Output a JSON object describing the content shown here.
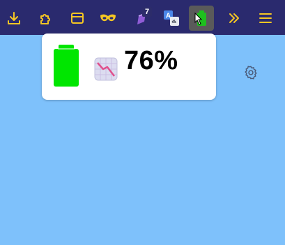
{
  "toolbar": {
    "background": "#2a2a6e",
    "icon_color": "#f5c623",
    "items": [
      {
        "name": "download",
        "icon": "download-icon"
      },
      {
        "name": "extensions",
        "icon": "puzzle-icon"
      },
      {
        "name": "sidebar",
        "icon": "window-icon"
      },
      {
        "name": "mask",
        "icon": "mask-icon"
      },
      {
        "name": "notes",
        "icon": "purple-extension-icon",
        "badge": "7"
      },
      {
        "name": "translate",
        "icon": "translate-icon"
      },
      {
        "name": "battery",
        "icon": "battery-extension-icon",
        "active": true
      },
      {
        "name": "more",
        "icon": "double-chevron-icon"
      },
      {
        "name": "menu",
        "icon": "hamburger-icon"
      }
    ]
  },
  "popup": {
    "battery_level": 76,
    "battery_level_text": "76%",
    "battery_color": "#00e600",
    "trend_icon": "chart-decreasing-icon"
  },
  "page": {
    "background": "#7ec1fb",
    "settings_icon": "gear-icon"
  }
}
